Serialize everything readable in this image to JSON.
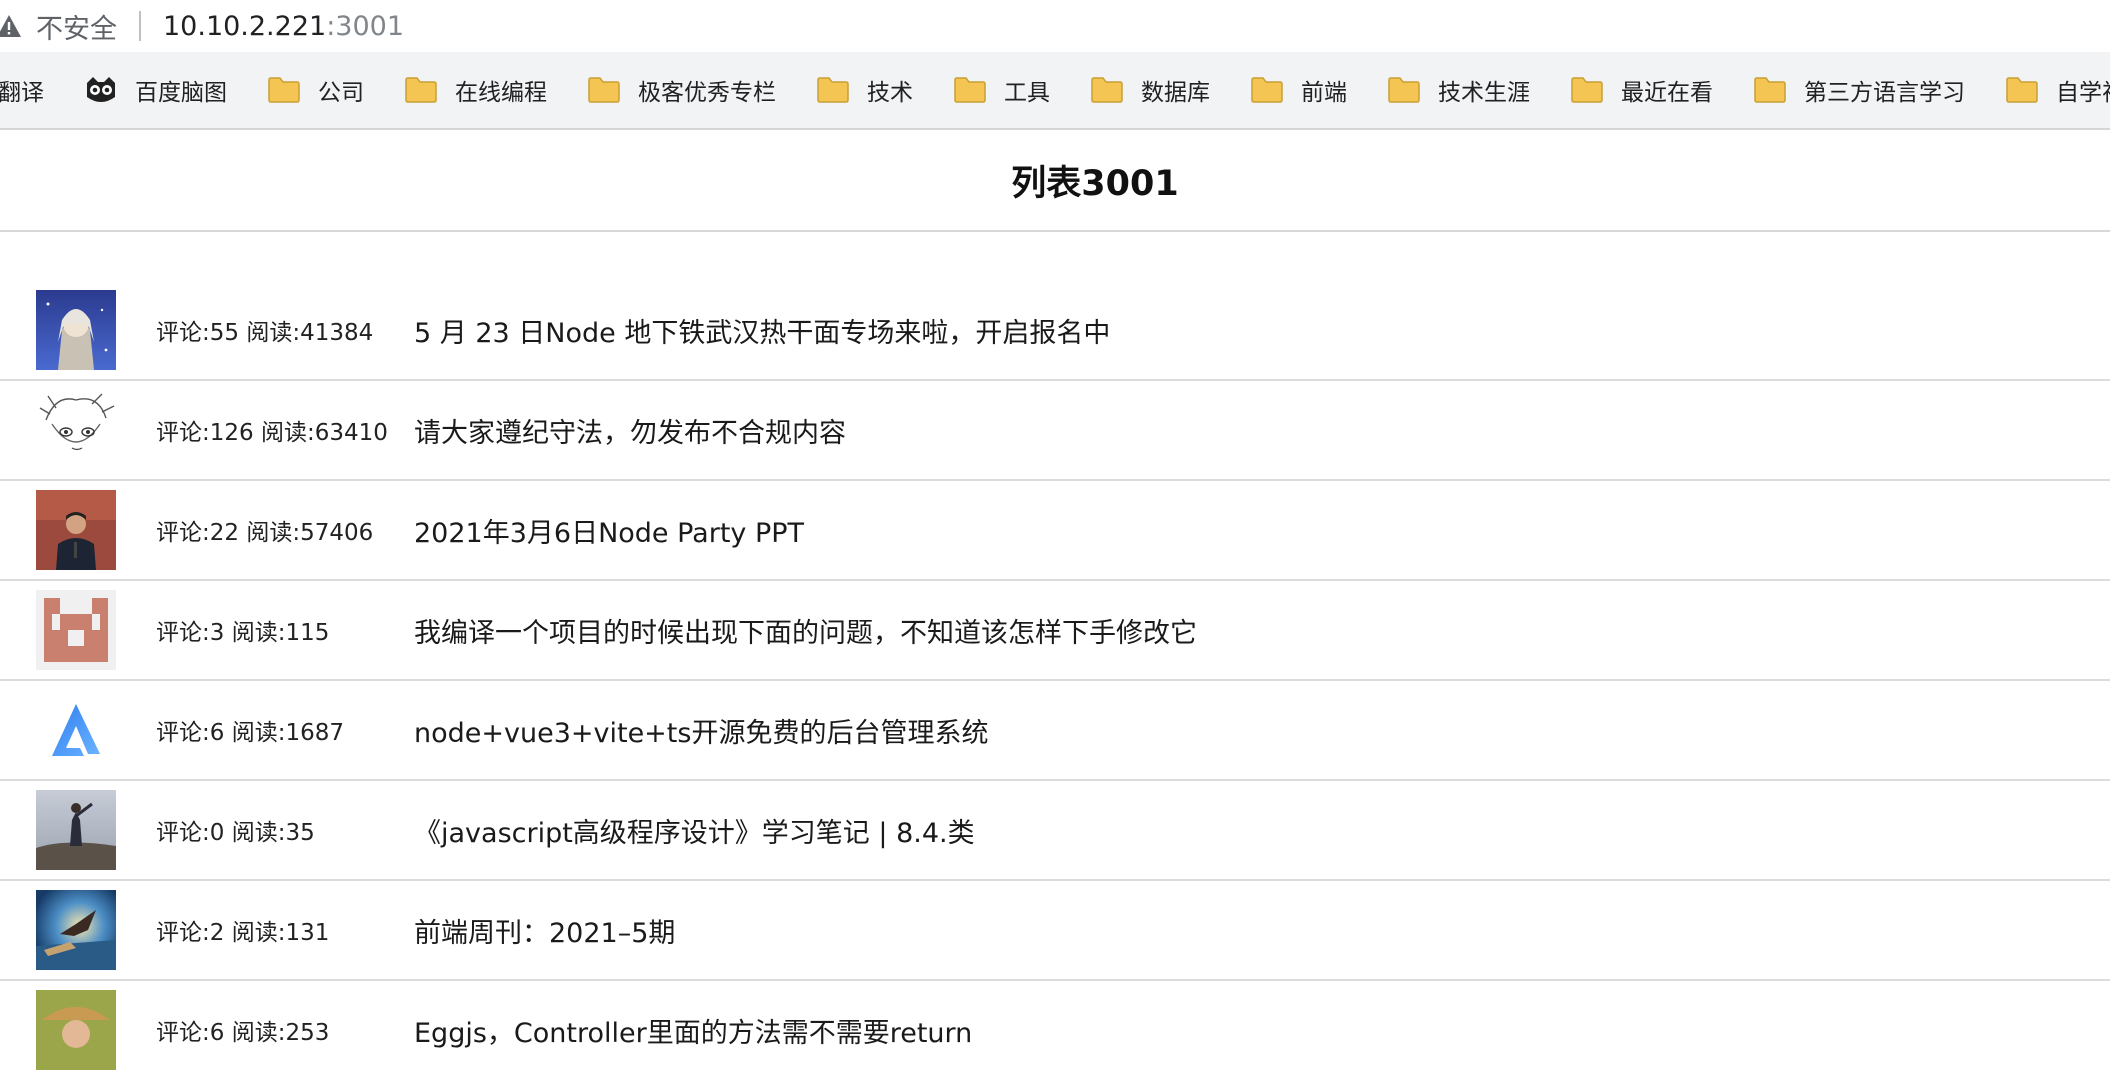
{
  "browser": {
    "security_label": "不安全",
    "host": "10.10.2.221",
    "port": ":3001"
  },
  "bookmarks": [
    {
      "label": "翻译",
      "icon": "none"
    },
    {
      "label": "百度脑图",
      "icon": "owl-icon"
    },
    {
      "label": "公司",
      "icon": "folder-icon"
    },
    {
      "label": "在线编程",
      "icon": "folder-icon"
    },
    {
      "label": "极客优秀专栏",
      "icon": "folder-icon"
    },
    {
      "label": "技术",
      "icon": "folder-icon"
    },
    {
      "label": "工具",
      "icon": "folder-icon"
    },
    {
      "label": "数据库",
      "icon": "folder-icon"
    },
    {
      "label": "前端",
      "icon": "folder-icon"
    },
    {
      "label": "技术生涯",
      "icon": "folder-icon"
    },
    {
      "label": "最近在看",
      "icon": "folder-icon"
    },
    {
      "label": "第三方语言学习",
      "icon": "folder-icon"
    },
    {
      "label": "自学视频",
      "icon": "folder-icon"
    }
  ],
  "page": {
    "title": "列表3001"
  },
  "items": [
    {
      "stats": "评论:55 阅读:41384",
      "title": "5 月 23 日Node 地下铁武汉热干面专场来啦，开启报名中",
      "avatar": "anime-avatar-icon"
    },
    {
      "stats": "评论:126 阅读:63410",
      "title": "请大家遵纪守法，勿发布不合规内容",
      "avatar": "sketch-avatar-icon"
    },
    {
      "stats": "评论:22 阅读:57406",
      "title": "2021年3月6日Node Party PPT",
      "avatar": "speaker-photo-icon"
    },
    {
      "stats": "评论:3 阅读:115",
      "title": "我编译一个项目的时候出现下面的问题，不知道该怎样下手修改它",
      "avatar": "identicon-icon"
    },
    {
      "stats": "评论:6 阅读:1687",
      "title": "node+vue3+vite+ts开源免费的后台管理系统",
      "avatar": "triangle-logo-icon"
    },
    {
      "stats": "评论:0 阅读:35",
      "title": "《javascript高级程序设计》学习笔记 | 8.4.类",
      "avatar": "rock-photo-icon"
    },
    {
      "stats": "评论:2 阅读:131",
      "title": "前端周刊：2021–5期",
      "avatar": "bird-photo-icon"
    },
    {
      "stats": "评论:6 阅读:253",
      "title": "Eggjs，Controller里面的方法需不需要return",
      "avatar": "hat-photo-icon"
    }
  ],
  "colors": {
    "bookmark_bar": "#f1f3f4",
    "folder": "#f4c553",
    "divider": "#dcdcdc"
  }
}
